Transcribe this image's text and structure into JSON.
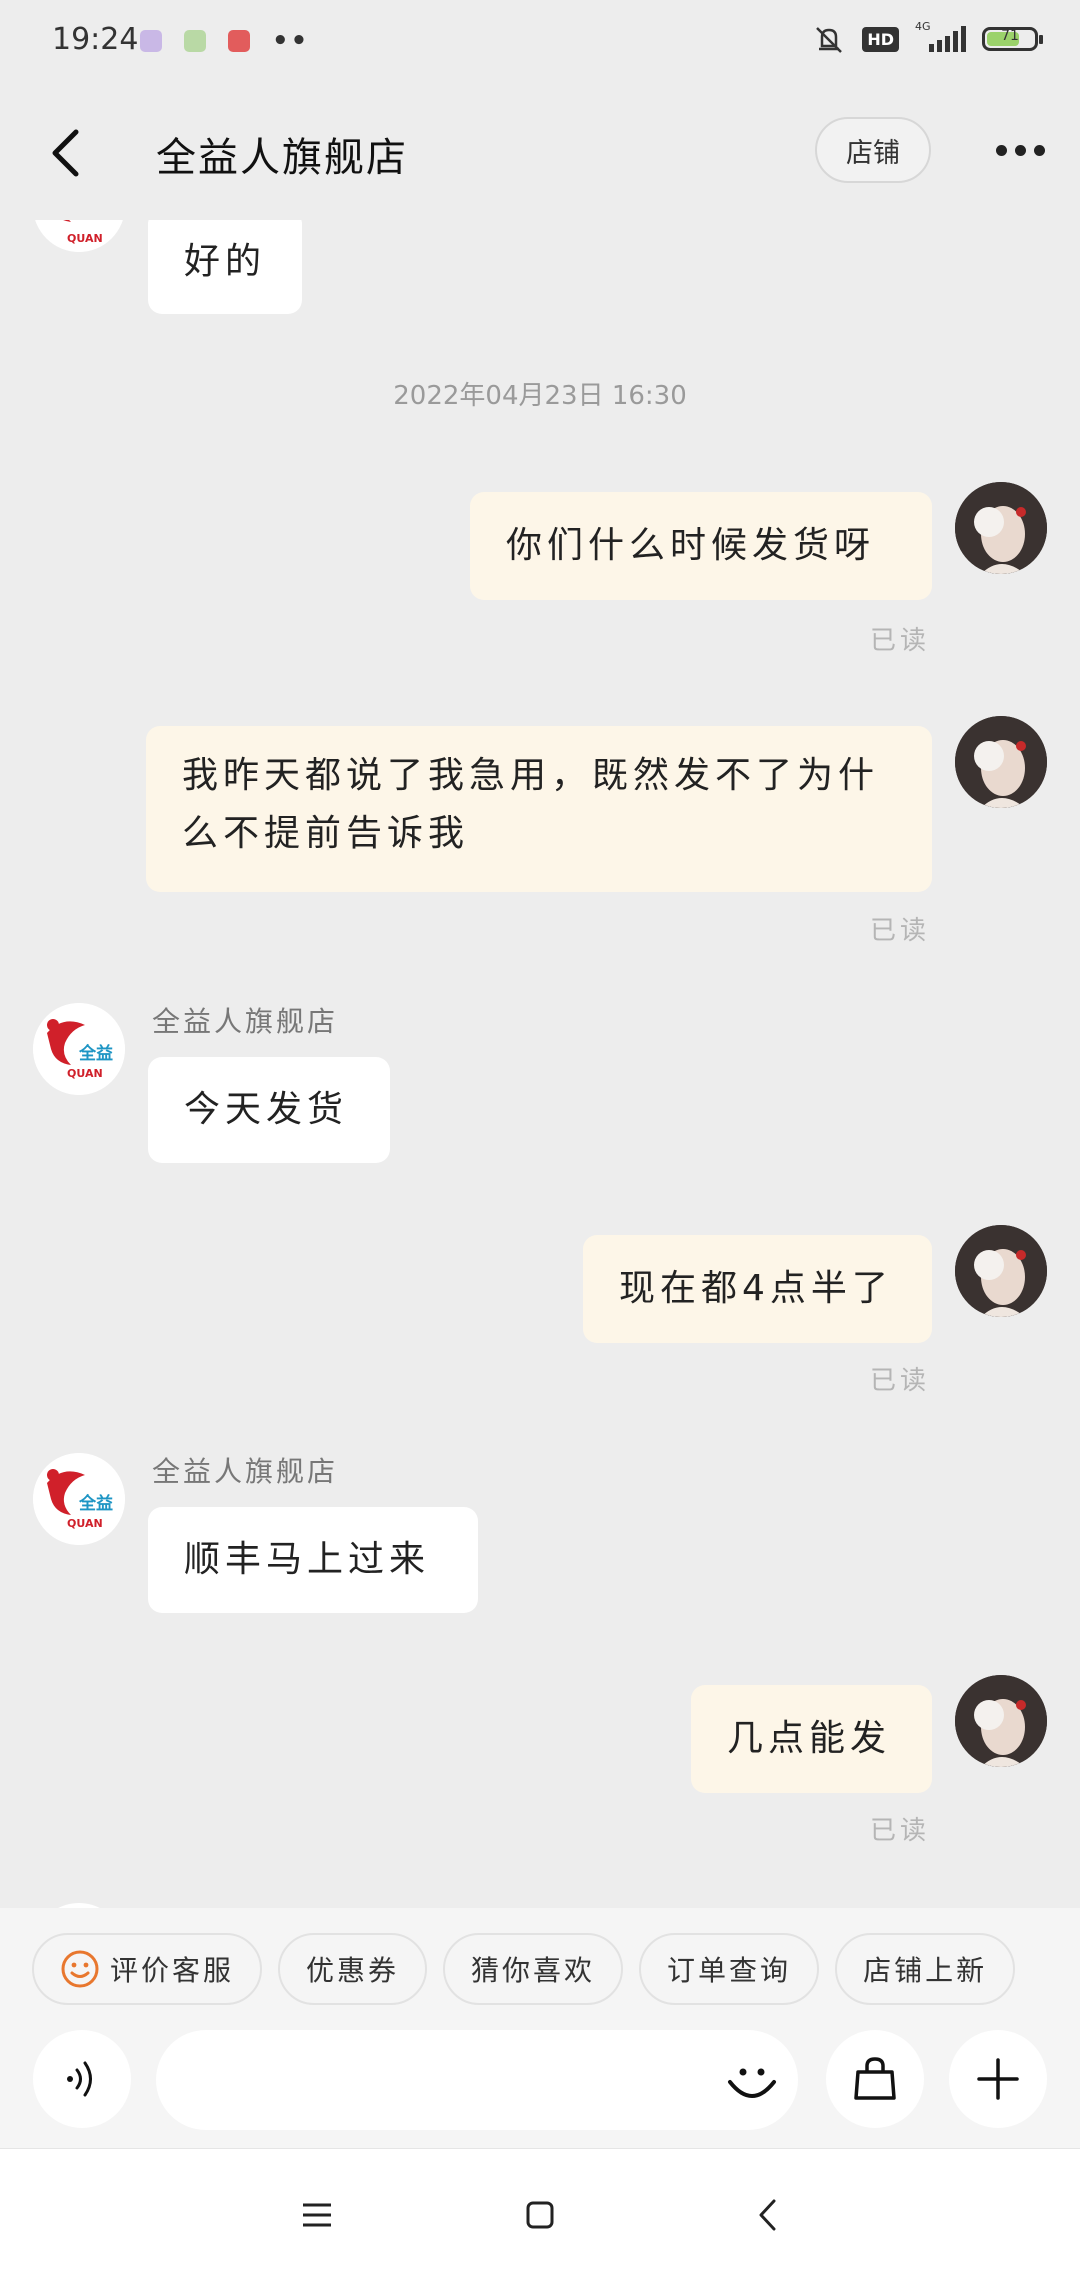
{
  "status_bar": {
    "time": "19:24",
    "network": "4G",
    "hd": "HD",
    "battery": "71"
  },
  "header": {
    "title": "全益人旗舰店",
    "shop_button": "店铺"
  },
  "chat": {
    "shop_name": "全益人旗舰店",
    "timestamp": "2022年04月23日  16:30",
    "read_label": "已读",
    "messages": [
      {
        "side": "in",
        "text": "好的"
      },
      {
        "side": "out",
        "text": "你们什么时候发货呀",
        "status": "已读"
      },
      {
        "side": "out",
        "text": "我昨天都说了我急用，既然发不了为什么不提前告诉我",
        "status": "已读"
      },
      {
        "side": "in",
        "sender": "全益人旗舰店",
        "text": "今天发货"
      },
      {
        "side": "out",
        "text": "现在都4点半了",
        "status": "已读"
      },
      {
        "side": "in",
        "sender": "全益人旗舰店",
        "text": "顺丰马上过来"
      },
      {
        "side": "out",
        "text": "几点能发",
        "status": "已读"
      }
    ]
  },
  "quick_actions": [
    "评价客服",
    "优惠券",
    "猜你喜欢",
    "订单查询",
    "店铺上新"
  ],
  "input": {
    "placeholder": ""
  },
  "colors": {
    "outgoing_bubble": "#fdf6e8",
    "incoming_bubble": "#ffffff",
    "background": "#ededed",
    "smile_icon": "#e8772e"
  }
}
